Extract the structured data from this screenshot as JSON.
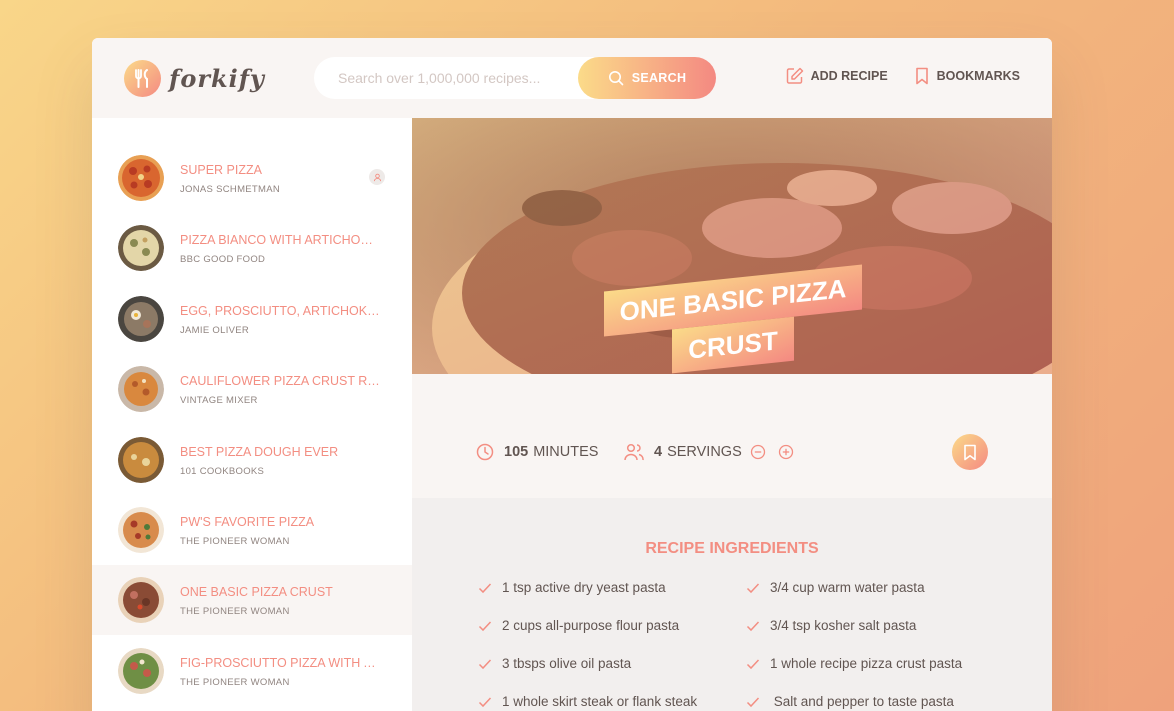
{
  "brand": {
    "name": "forkify"
  },
  "search": {
    "placeholder": "Search over 1,000,000 recipes...",
    "value": "",
    "button_label": "SEARCH"
  },
  "nav": {
    "add_recipe": "ADD RECIPE",
    "bookmarks": "BOOKMARKS"
  },
  "results": [
    {
      "title": "SUPER PIZZA",
      "publisher": "JONAS SCHMETMAN",
      "user_generated": true,
      "active": false
    },
    {
      "title": "PIZZA BIANCO WITH ARTICHOKE ...",
      "publisher": "BBC GOOD FOOD",
      "active": false
    },
    {
      "title": "EGG, PROSCIUTTO, ARTICHOKES, ...",
      "publisher": "JAMIE OLIVER",
      "active": false
    },
    {
      "title": "CAULIFLOWER PIZZA CRUST RECI...",
      "publisher": "VINTAGE MIXER",
      "active": false
    },
    {
      "title": "BEST PIZZA DOUGH EVER",
      "publisher": "101 COOKBOOKS",
      "active": false
    },
    {
      "title": "PW'S FAVORITE PIZZA",
      "publisher": "THE PIONEER WOMAN",
      "active": false
    },
    {
      "title": "ONE BASIC PIZZA CRUST",
      "publisher": "THE PIONEER WOMAN",
      "active": true
    },
    {
      "title": "FIG-PROSCIUTTO PIZZA WITH AR...",
      "publisher": "THE PIONEER WOMAN",
      "active": false
    }
  ],
  "recipe": {
    "title_line1": "ONE BASIC PIZZA",
    "title_line2": "CRUST",
    "minutes_value": "105",
    "minutes_unit": "MINUTES",
    "servings_value": "4",
    "servings_unit": "SERVINGS",
    "ingredients_heading": "RECIPE INGREDIENTS",
    "ingredients": [
      "1 tsp active dry yeast pasta",
      "3/4 cup warm water pasta",
      "2 cups all-purpose flour pasta",
      "3/4 tsp kosher salt pasta",
      "3 tbsps olive oil pasta",
      "1 whole recipe pizza crust pasta",
      "1 whole skirt steak or flank steak",
      " Salt and pepper to taste pasta"
    ]
  },
  "colors": {
    "accent": "#f38e82",
    "grad_start": "#fbdb89",
    "grad_end": "#f48982",
    "text": "#615551"
  }
}
